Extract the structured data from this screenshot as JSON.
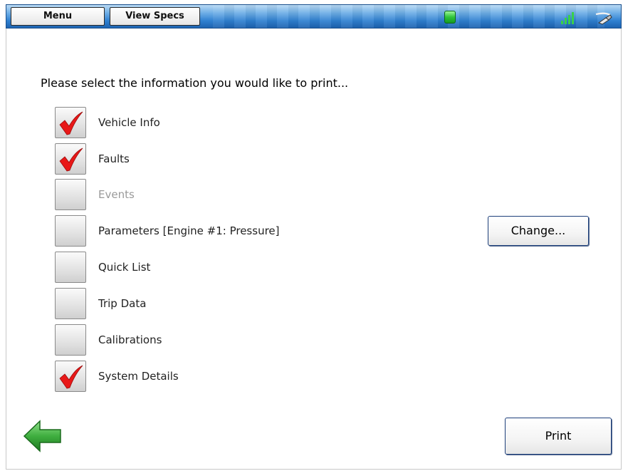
{
  "toolbar": {
    "menu_label": "Menu",
    "specs_label": "View Specs",
    "status_icon": "connection-status-led",
    "signal_icon": "signal-strength-icon",
    "link_icon": "cable-connector-icon",
    "status_color": "#2fc43a"
  },
  "heading": "Please select the information you would like to print...",
  "items": [
    {
      "label": "Vehicle Info",
      "checked": true,
      "enabled": true
    },
    {
      "label": "Faults",
      "checked": true,
      "enabled": true
    },
    {
      "label": "Events",
      "checked": false,
      "enabled": false
    },
    {
      "label": "Parameters [Engine #1: Pressure]",
      "checked": false,
      "enabled": true
    },
    {
      "label": "Quick List",
      "checked": false,
      "enabled": true
    },
    {
      "label": "Trip Data",
      "checked": false,
      "enabled": true
    },
    {
      "label": "Calibrations",
      "checked": false,
      "enabled": true
    },
    {
      "label": "System Details",
      "checked": true,
      "enabled": true
    }
  ],
  "buttons": {
    "change_label": "Change...",
    "print_label": "Print"
  },
  "colors": {
    "checkmark": "#e81818",
    "back_arrow": "#3fae3f",
    "toolbar": "#2e7fd0"
  }
}
